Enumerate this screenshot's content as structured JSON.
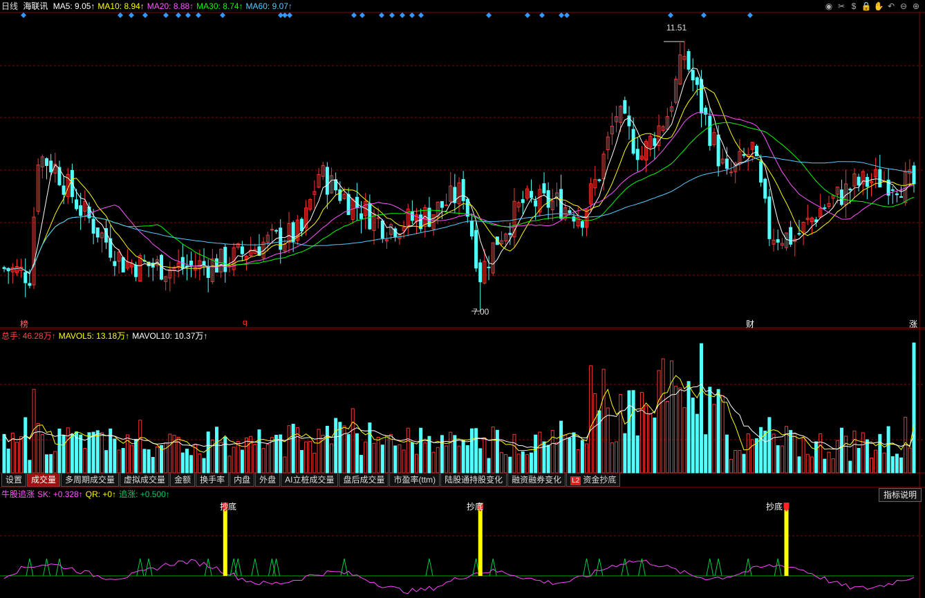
{
  "header": {
    "period": "日线",
    "stock": "海联讯",
    "ma": [
      {
        "label": "MA5:",
        "value": "9.05",
        "color": "#ffffff"
      },
      {
        "label": "MA10:",
        "value": "8.94",
        "color": "#ffff00"
      },
      {
        "label": "MA20:",
        "value": "8.88",
        "color": "#ff55ff"
      },
      {
        "label": "MA30:",
        "value": "8.74",
        "color": "#00ff00"
      },
      {
        "label": "MA60:",
        "value": "9.07",
        "color": "#55ccff"
      }
    ],
    "up_arrow": "↑"
  },
  "toolbar_icons": [
    "eye-icon",
    "scissors-icon",
    "dollar-icon",
    "lock-icon",
    "hand-icon",
    "undo-icon",
    "minus-icon",
    "plus-icon"
  ],
  "toolbar_glyphs": [
    "◉",
    "✂",
    "$",
    "🔒",
    "✋",
    "↶",
    "⊖",
    "⊕"
  ],
  "price_labels": {
    "high": "11.51",
    "low": "7.00"
  },
  "event_markers": [
    {
      "text": "榜",
      "color": "#ff6666"
    },
    {
      "text": "q",
      "color": "#ff3333"
    },
    {
      "text": "财",
      "color": "#ffffff"
    },
    {
      "text": "涨",
      "color": "#ffffff"
    }
  ],
  "volume_header": [
    {
      "label": "总手:",
      "value": "46.28万",
      "color": "#ff4444"
    },
    {
      "label": "MAVOL5:",
      "value": "13.18万",
      "color": "#ffff00"
    },
    {
      "label": "MAVOL10:",
      "value": "10.37万",
      "color": "#ffffff"
    }
  ],
  "tabs": [
    "设置",
    "成交量",
    "多周期成交量",
    "虚拟成交量",
    "金额",
    "换手率",
    "内盘",
    "外盘",
    "AI立桩成交量",
    "盘后成交量",
    "市盈率(ttm)",
    "陆股通持股变化",
    "融资融券变化",
    "资金抄底"
  ],
  "active_tab": "成交量",
  "l2_badge": "L2",
  "indicator_header": [
    {
      "label": "牛股追涨",
      "value": "",
      "color": "#ff55ff"
    },
    {
      "label": "SK:",
      "value": "+0.328",
      "color": "#ff55ff"
    },
    {
      "label": "QR:",
      "value": "+0",
      "color": "#ffff00"
    },
    {
      "label": "追涨:",
      "value": "+0.500",
      "color": "#00cc66"
    }
  ],
  "indicator_button": "指标说明",
  "signal_label": "抄底",
  "colors": {
    "up": "#ff3333",
    "down": "#54ffff",
    "grid": "#8b0000",
    "ma5": "#ffffff",
    "ma10": "#ffff00",
    "ma20": "#ff55ff",
    "ma30": "#00ff00",
    "ma60": "#55ccff"
  },
  "chart_data": {
    "type": "candlestick",
    "title": "海联讯 日线",
    "price_high": 11.51,
    "price_low": 7.0,
    "ylim": [
      6.7,
      12.0
    ],
    "current": {
      "MA5": 9.05,
      "MA10": 8.94,
      "MA20": 8.88,
      "MA30": 8.74,
      "MA60": 9.07
    },
    "volume": {
      "total_hands_wan": 46.28,
      "MAVOL5_wan": 13.18,
      "MAVOL10_wan": 10.37
    },
    "indicator": {
      "name": "牛股追涨",
      "SK": 0.328,
      "QR": 0,
      "追涨": 0.5
    },
    "signals_index": [
      52,
      112,
      184
    ]
  }
}
